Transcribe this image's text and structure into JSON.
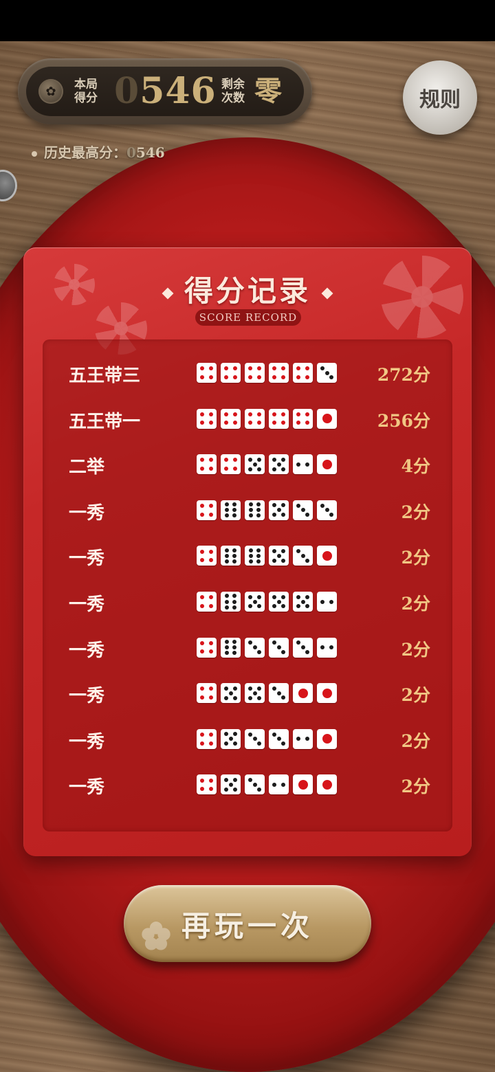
{
  "hud": {
    "score_label_1": "本局",
    "score_label_2": "得分",
    "score_lead": "0",
    "score_value": "546",
    "remain_label_1": "剩余",
    "remain_label_2": "次数",
    "remain_value": "零",
    "rules_label": "规则"
  },
  "history": {
    "label": "历史最高分：",
    "lead": "0",
    "value": "546"
  },
  "panel": {
    "title": "得分记录",
    "subtitle": "SCORE RECORD"
  },
  "records": [
    {
      "name": "五王带三",
      "dice": [
        4,
        4,
        4,
        4,
        4,
        3
      ],
      "points": "272分"
    },
    {
      "name": "五王带一",
      "dice": [
        4,
        4,
        4,
        4,
        4,
        1
      ],
      "points": "256分"
    },
    {
      "name": "二举",
      "dice": [
        4,
        4,
        5,
        5,
        2,
        1
      ],
      "points": "4分"
    },
    {
      "name": "一秀",
      "dice": [
        4,
        6,
        6,
        5,
        3,
        3
      ],
      "points": "2分"
    },
    {
      "name": "一秀",
      "dice": [
        4,
        6,
        6,
        5,
        3,
        1
      ],
      "points": "2分"
    },
    {
      "name": "一秀",
      "dice": [
        4,
        6,
        5,
        5,
        5,
        2
      ],
      "points": "2分"
    },
    {
      "name": "一秀",
      "dice": [
        4,
        6,
        3,
        3,
        3,
        2
      ],
      "points": "2分"
    },
    {
      "name": "一秀",
      "dice": [
        4,
        5,
        5,
        3,
        1,
        1
      ],
      "points": "2分"
    },
    {
      "name": "一秀",
      "dice": [
        4,
        5,
        3,
        3,
        2,
        1
      ],
      "points": "2分"
    },
    {
      "name": "一秀",
      "dice": [
        4,
        5,
        3,
        2,
        1,
        1
      ],
      "points": "2分"
    }
  ],
  "replay_label": "再玩一次",
  "colors": {
    "pip_black": "#1c1c1c",
    "pip_red": "#d7141a",
    "points_gold": "#f1c784"
  }
}
